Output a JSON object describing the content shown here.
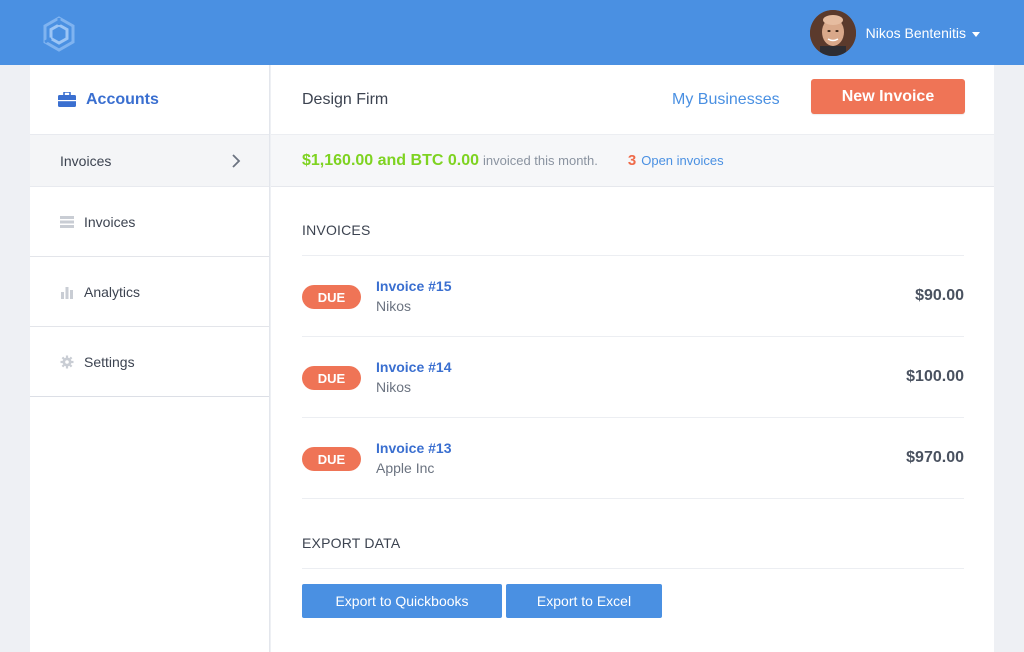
{
  "header": {
    "user_name": "Nikos Bentenitis",
    "brand_color": "#4a90e2"
  },
  "sidebar": {
    "section_label": "Accounts",
    "section_icon": "briefcase-icon",
    "active_label": "Invoices",
    "items": [
      {
        "label": "Invoices",
        "icon": "list-icon"
      },
      {
        "label": "Analytics",
        "icon": "bar-chart-icon"
      },
      {
        "label": "Settings",
        "icon": "gear-icon"
      }
    ]
  },
  "main": {
    "firm_name": "Design Firm",
    "my_businesses_label": "My Businesses",
    "new_invoice_label": "New Invoice",
    "summary": {
      "amount": "$1,160.00 and BTC 0.00",
      "amount_suffix": "invoiced this month.",
      "open_count": "3",
      "open_label": "Open invoices"
    },
    "invoices_title": "INVOICES",
    "invoices": [
      {
        "status": "DUE",
        "name": "Invoice #15",
        "client": "Nikos",
        "amount": "$90.00"
      },
      {
        "status": "DUE",
        "name": "Invoice #14",
        "client": "Nikos",
        "amount": "$100.00"
      },
      {
        "status": "DUE",
        "name": "Invoice #13",
        "client": "Apple Inc",
        "amount": "$970.00"
      }
    ],
    "export_title": "EXPORT DATA",
    "export_quickbooks_label": "Export to Quickbooks",
    "export_excel_label": "Export to Excel"
  },
  "colors": {
    "accent_orange": "#ef7456",
    "amount_green": "#7ed321",
    "link_blue": "#3a6fd0"
  }
}
